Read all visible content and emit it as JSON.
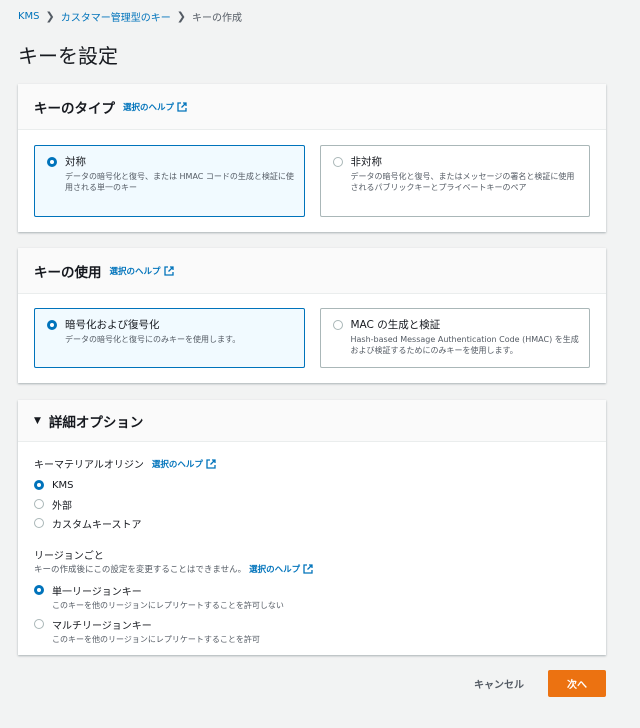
{
  "breadcrumb": {
    "items": [
      "KMS",
      "カスタマー管理型のキー",
      "キーの作成"
    ]
  },
  "page": {
    "title": "キーを設定"
  },
  "help_label": "選択のヘルプ",
  "key_type": {
    "title": "キーのタイプ",
    "options": [
      {
        "label": "対称",
        "desc": "データの暗号化と復号、または HMAC コードの生成と検証に使用される単一のキー",
        "selected": true
      },
      {
        "label": "非対称",
        "desc": "データの暗号化と復号、またはメッセージの署名と検証に使用されるパブリックキーとプライベートキーのペア",
        "selected": false
      }
    ]
  },
  "key_usage": {
    "title": "キーの使用",
    "options": [
      {
        "label": "暗号化および復号化",
        "desc": "データの暗号化と復号にのみキーを使用します。",
        "selected": true
      },
      {
        "label": "MAC の生成と検証",
        "desc": "Hash-based Message Authentication Code (HMAC) を生成および検証するためにのみキーを使用します。",
        "selected": false
      }
    ]
  },
  "advanced": {
    "title": "詳細オプション",
    "origin": {
      "label": "キーマテリアルオリジン",
      "options": [
        {
          "label": "KMS",
          "selected": true
        },
        {
          "label": "外部",
          "selected": false
        },
        {
          "label": "カスタムキーストア",
          "selected": false
        }
      ]
    },
    "regionality": {
      "label": "リージョンごと",
      "desc": "キーの作成後にこの設定を変更することはできません。",
      "options": [
        {
          "label": "単一リージョンキー",
          "desc": "このキーを他のリージョンにレプリケートすることを許可しない",
          "selected": true
        },
        {
          "label": "マルチリージョンキー",
          "desc": "このキーを他のリージョンにレプリケートすることを許可",
          "selected": false
        }
      ]
    }
  },
  "footer": {
    "cancel": "キャンセル",
    "next": "次へ"
  },
  "colors": {
    "accent": "#0073bb",
    "primary_button": "#ec7211",
    "background": "#f2f3f3"
  }
}
